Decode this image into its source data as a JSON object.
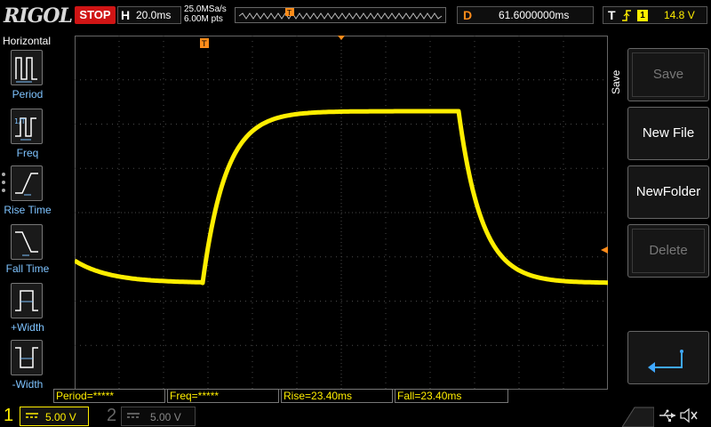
{
  "brand": {
    "logo": "RIGOL"
  },
  "run_state": {
    "label": "STOP",
    "color": "#d01515"
  },
  "horizontal": {
    "label": "H",
    "timebase": "20.0ms"
  },
  "acquisition": {
    "sample_rate": "25.0MSa/s",
    "memory_depth": "6.00M pts"
  },
  "delay": {
    "label": "D",
    "value": "61.6000000ms"
  },
  "trigger": {
    "label": "T",
    "edge_icon": "rising-edge-icon",
    "source": "1",
    "level": "14.8 V"
  },
  "left_menu": {
    "title": "Horizontal",
    "items": [
      {
        "label": "Period",
        "icon": "period-icon"
      },
      {
        "label": "Freq",
        "icon": "freq-icon"
      },
      {
        "label": "Rise Time",
        "icon": "rise-time-icon"
      },
      {
        "label": "Fall Time",
        "icon": "fall-time-icon"
      },
      {
        "label": "+Width",
        "icon": "pos-width-icon"
      },
      {
        "label": "-Width",
        "icon": "neg-width-icon"
      }
    ]
  },
  "right_menu": {
    "title": "Save",
    "buttons": [
      {
        "label": "Save",
        "enabled": false
      },
      {
        "label": "New File",
        "enabled": true
      },
      {
        "label": "NewFolder",
        "enabled": true
      },
      {
        "label": "Delete",
        "enabled": false
      }
    ],
    "return_icon": "return-arrow-icon"
  },
  "markers": {
    "trigger_pos": "T",
    "ground_marker": "1"
  },
  "measurements": [
    {
      "label": "Period=*****"
    },
    {
      "label": "Freq=*****"
    },
    {
      "label": "Rise=23.40ms"
    },
    {
      "label": "Fall=23.40ms"
    }
  ],
  "channels": [
    {
      "number": "1",
      "scale": "5.00 V",
      "active": true,
      "color": "#ffee00"
    },
    {
      "number": "2",
      "scale": "5.00 V",
      "active": false,
      "color": "#888888"
    }
  ],
  "status_icons": [
    "usb-icon",
    "speaker-muted-icon"
  ],
  "colors": {
    "trace": "#ffee00",
    "grid": "#4a4a4a",
    "accent": "#ff8c1a",
    "label_blue": "#7ec3ff"
  }
}
